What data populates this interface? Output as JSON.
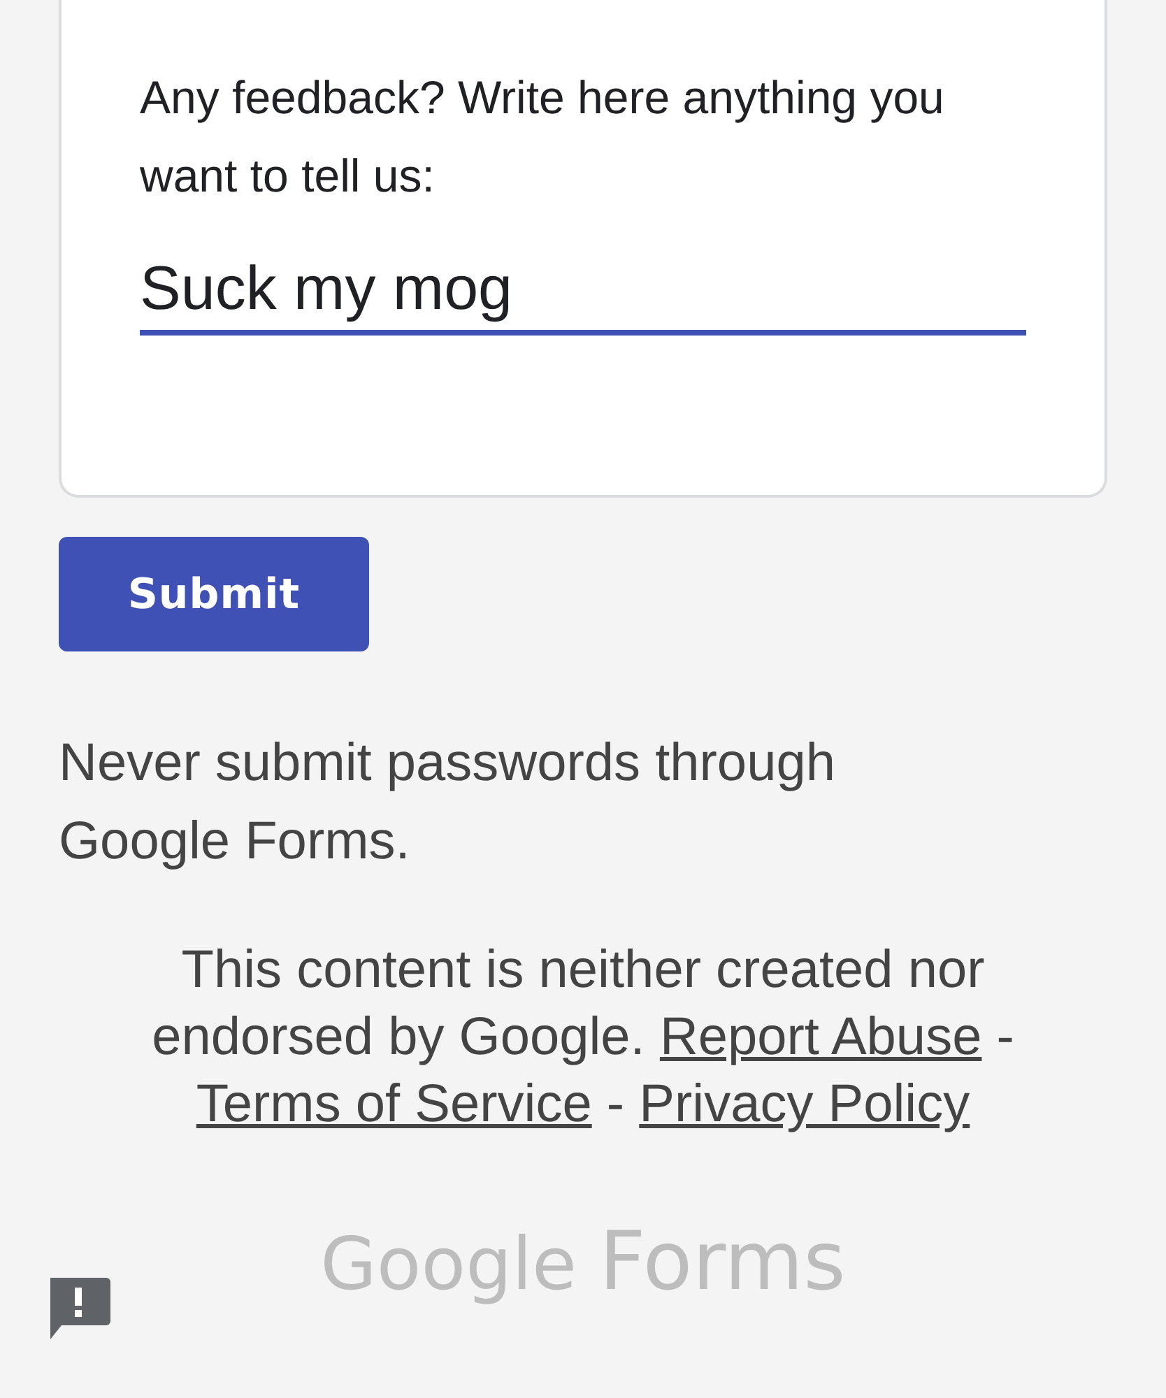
{
  "question": {
    "label": "Any feedback? Write here anything you want to tell us:",
    "value": "Suck my mog"
  },
  "submit_button": "Submit",
  "warning": "Never submit passwords through Google Forms.",
  "footer": {
    "text": "This content is neither created nor endorsed by Google.",
    "links": [
      {
        "label": "Report Abuse"
      },
      {
        "label": "Terms of Service"
      },
      {
        "label": "Privacy Policy"
      }
    ],
    "separator": "-"
  },
  "logo": {
    "brand": "Google",
    "product": "Forms"
  }
}
